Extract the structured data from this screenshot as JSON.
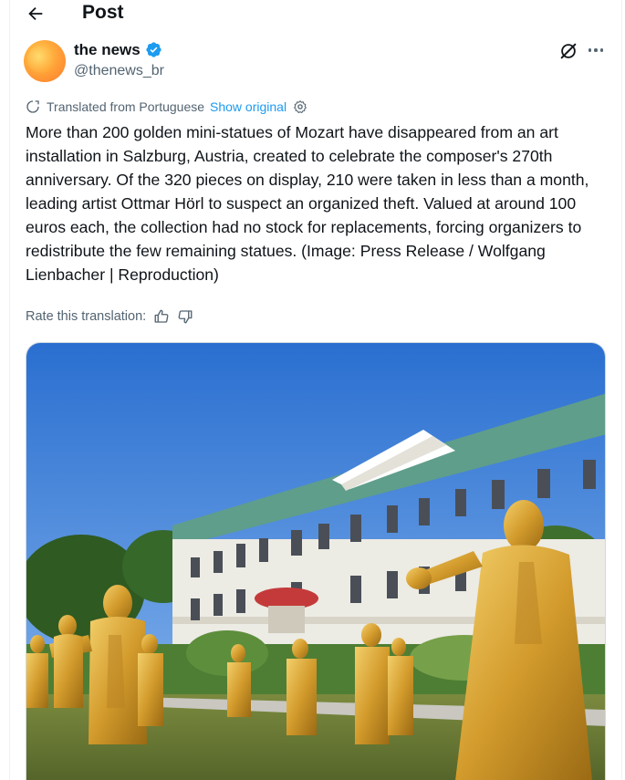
{
  "header": {
    "title": "Post",
    "back_icon": "arrow-left-icon"
  },
  "author": {
    "name": "the news",
    "handle": "@thenews_br",
    "verified": true,
    "avatar_colors": [
      "#ffcf4a",
      "#ff7a2a"
    ]
  },
  "actions": {
    "grok_icon": "grok-icon",
    "more_icon": "more-horizontal-icon"
  },
  "translation": {
    "label": "Translated from Portuguese",
    "show_original": "Show original",
    "settings_icon": "gear-icon"
  },
  "post": {
    "text": "More than 200 golden mini-statues of Mozart have disappeared from an art installation in Salzburg, Austria, created to celebrate the composer's 270th anniversary. Of the 320 pieces on display, 210 were taken in less than a month, leading artist Ottmar Hörl to suspect an organized theft. Valued at around 100 euros each, the collection had no stock for replacements, forcing organizers to redistribute the few remaining statues. (Image: Press Release / Wolfgang Lienbacher | Reproduction)"
  },
  "rating": {
    "label": "Rate this translation:",
    "up_icon": "thumbs-up-icon",
    "down_icon": "thumbs-down-icon"
  },
  "colors": {
    "link": "#1d9bf0",
    "secondary_text": "#536471",
    "verified": "#1d9bf0"
  }
}
